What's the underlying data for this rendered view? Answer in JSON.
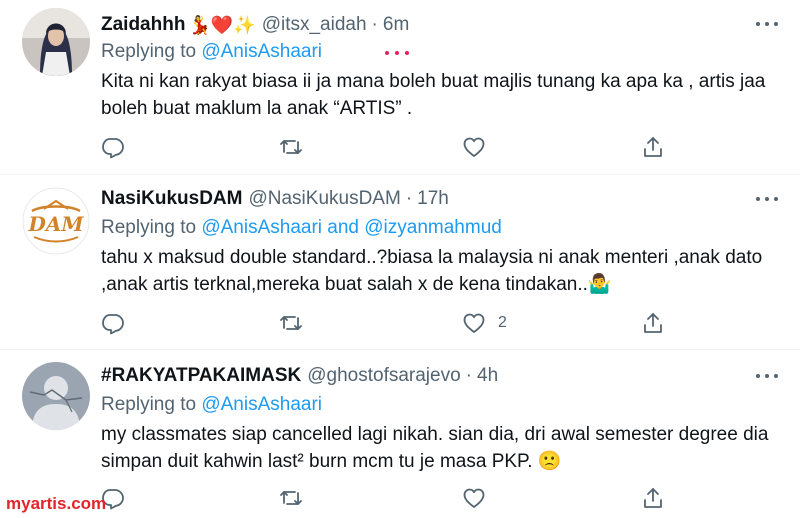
{
  "tweets": [
    {
      "name": "Zaidahhh",
      "name_emoji": "💃❤️✨",
      "handle": "@itsx_aidah",
      "dot": "·",
      "time": "6m",
      "replying_prefix": "Replying to",
      "replying_to": "@AnisAshaari",
      "text": "Kita ni kan rakyat biasa ii ja mana boleh buat majlis tunang ka apa ka , artis jaa boleh buat maklum la anak “ARTIS” .",
      "like_count": ""
    },
    {
      "name": "NasiKukusDAM",
      "name_emoji": "",
      "handle": "@NasiKukusDAM",
      "dot": "·",
      "time": "17h",
      "replying_prefix": "Replying to",
      "replying_to": "@AnisAshaari and @izyanmahmud",
      "text": "tahu x maksud double standard..?biasa la malaysia ni anak menteri ,anak dato ,anak artis terknal,mereka buat salah x de kena tindakan..🤷‍♂️",
      "like_count": "2"
    },
    {
      "name": "#RAKYATPAKAIMASK",
      "name_emoji": "",
      "handle": "@ghostofsarajevo",
      "dot": "·",
      "time": "4h",
      "replying_prefix": "Replying to",
      "replying_to": "@AnisAshaari",
      "text": "my classmates siap cancelled lagi nikah. sian dia, dri awal semester degree dia simpan duit kahwin last² burn mcm tu je masa PKP. 🙁",
      "like_count": ""
    }
  ],
  "icons": {
    "reply": "reply-icon",
    "retweet": "retweet-icon",
    "like": "like-icon",
    "share": "share-icon",
    "more": "more-icon"
  },
  "colors": {
    "link": "#1d9bf0",
    "secondary_text": "#536471",
    "watermark": "#e3242b"
  },
  "watermark": "myartis.com"
}
